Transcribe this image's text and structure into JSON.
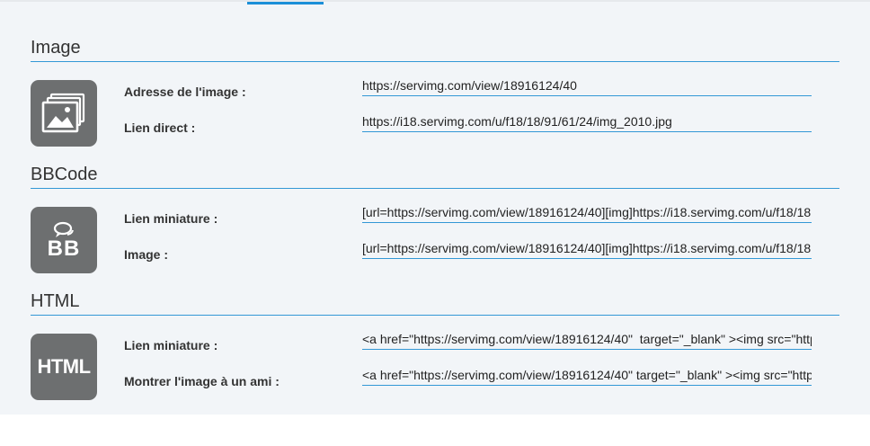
{
  "sections": {
    "image": {
      "title": "Image",
      "icon": "image-gallery-icon",
      "rows": [
        {
          "label": "Adresse de l'image :",
          "value": "https://servimg.com/view/18916124/40"
        },
        {
          "label": "Lien direct :",
          "value": "https://i18.servimg.com/u/f18/18/91/61/24/img_2010.jpg"
        }
      ]
    },
    "bbcode": {
      "title": "BBCode",
      "icon": "bbcode-chat-icon",
      "icon_text": "BB",
      "rows": [
        {
          "label": "Lien miniature :",
          "value": "[url=https://servimg.com/view/18916124/40][img]https://i18.servimg.com/u/f18/18"
        },
        {
          "label": "Image :",
          "value": "[url=https://servimg.com/view/18916124/40][img]https://i18.servimg.com/u/f18/18"
        }
      ]
    },
    "html": {
      "title": "HTML",
      "icon": "html-icon",
      "icon_text": "HTML",
      "rows": [
        {
          "label": "Lien miniature :",
          "value": "<a href=\"https://servimg.com/view/18916124/40\"  target=\"_blank\" ><img src=\"http"
        },
        {
          "label": "Montrer l'image à un ami :",
          "value": "<a href=\"https://servimg.com/view/18916124/40\" target=\"_blank\" ><img src=\"http"
        }
      ]
    }
  },
  "colors": {
    "accent": "#1b8fd8",
    "divider": "#3398d6",
    "icon_bg": "#6d6f70",
    "panel_bg": "#f2f5f8"
  }
}
